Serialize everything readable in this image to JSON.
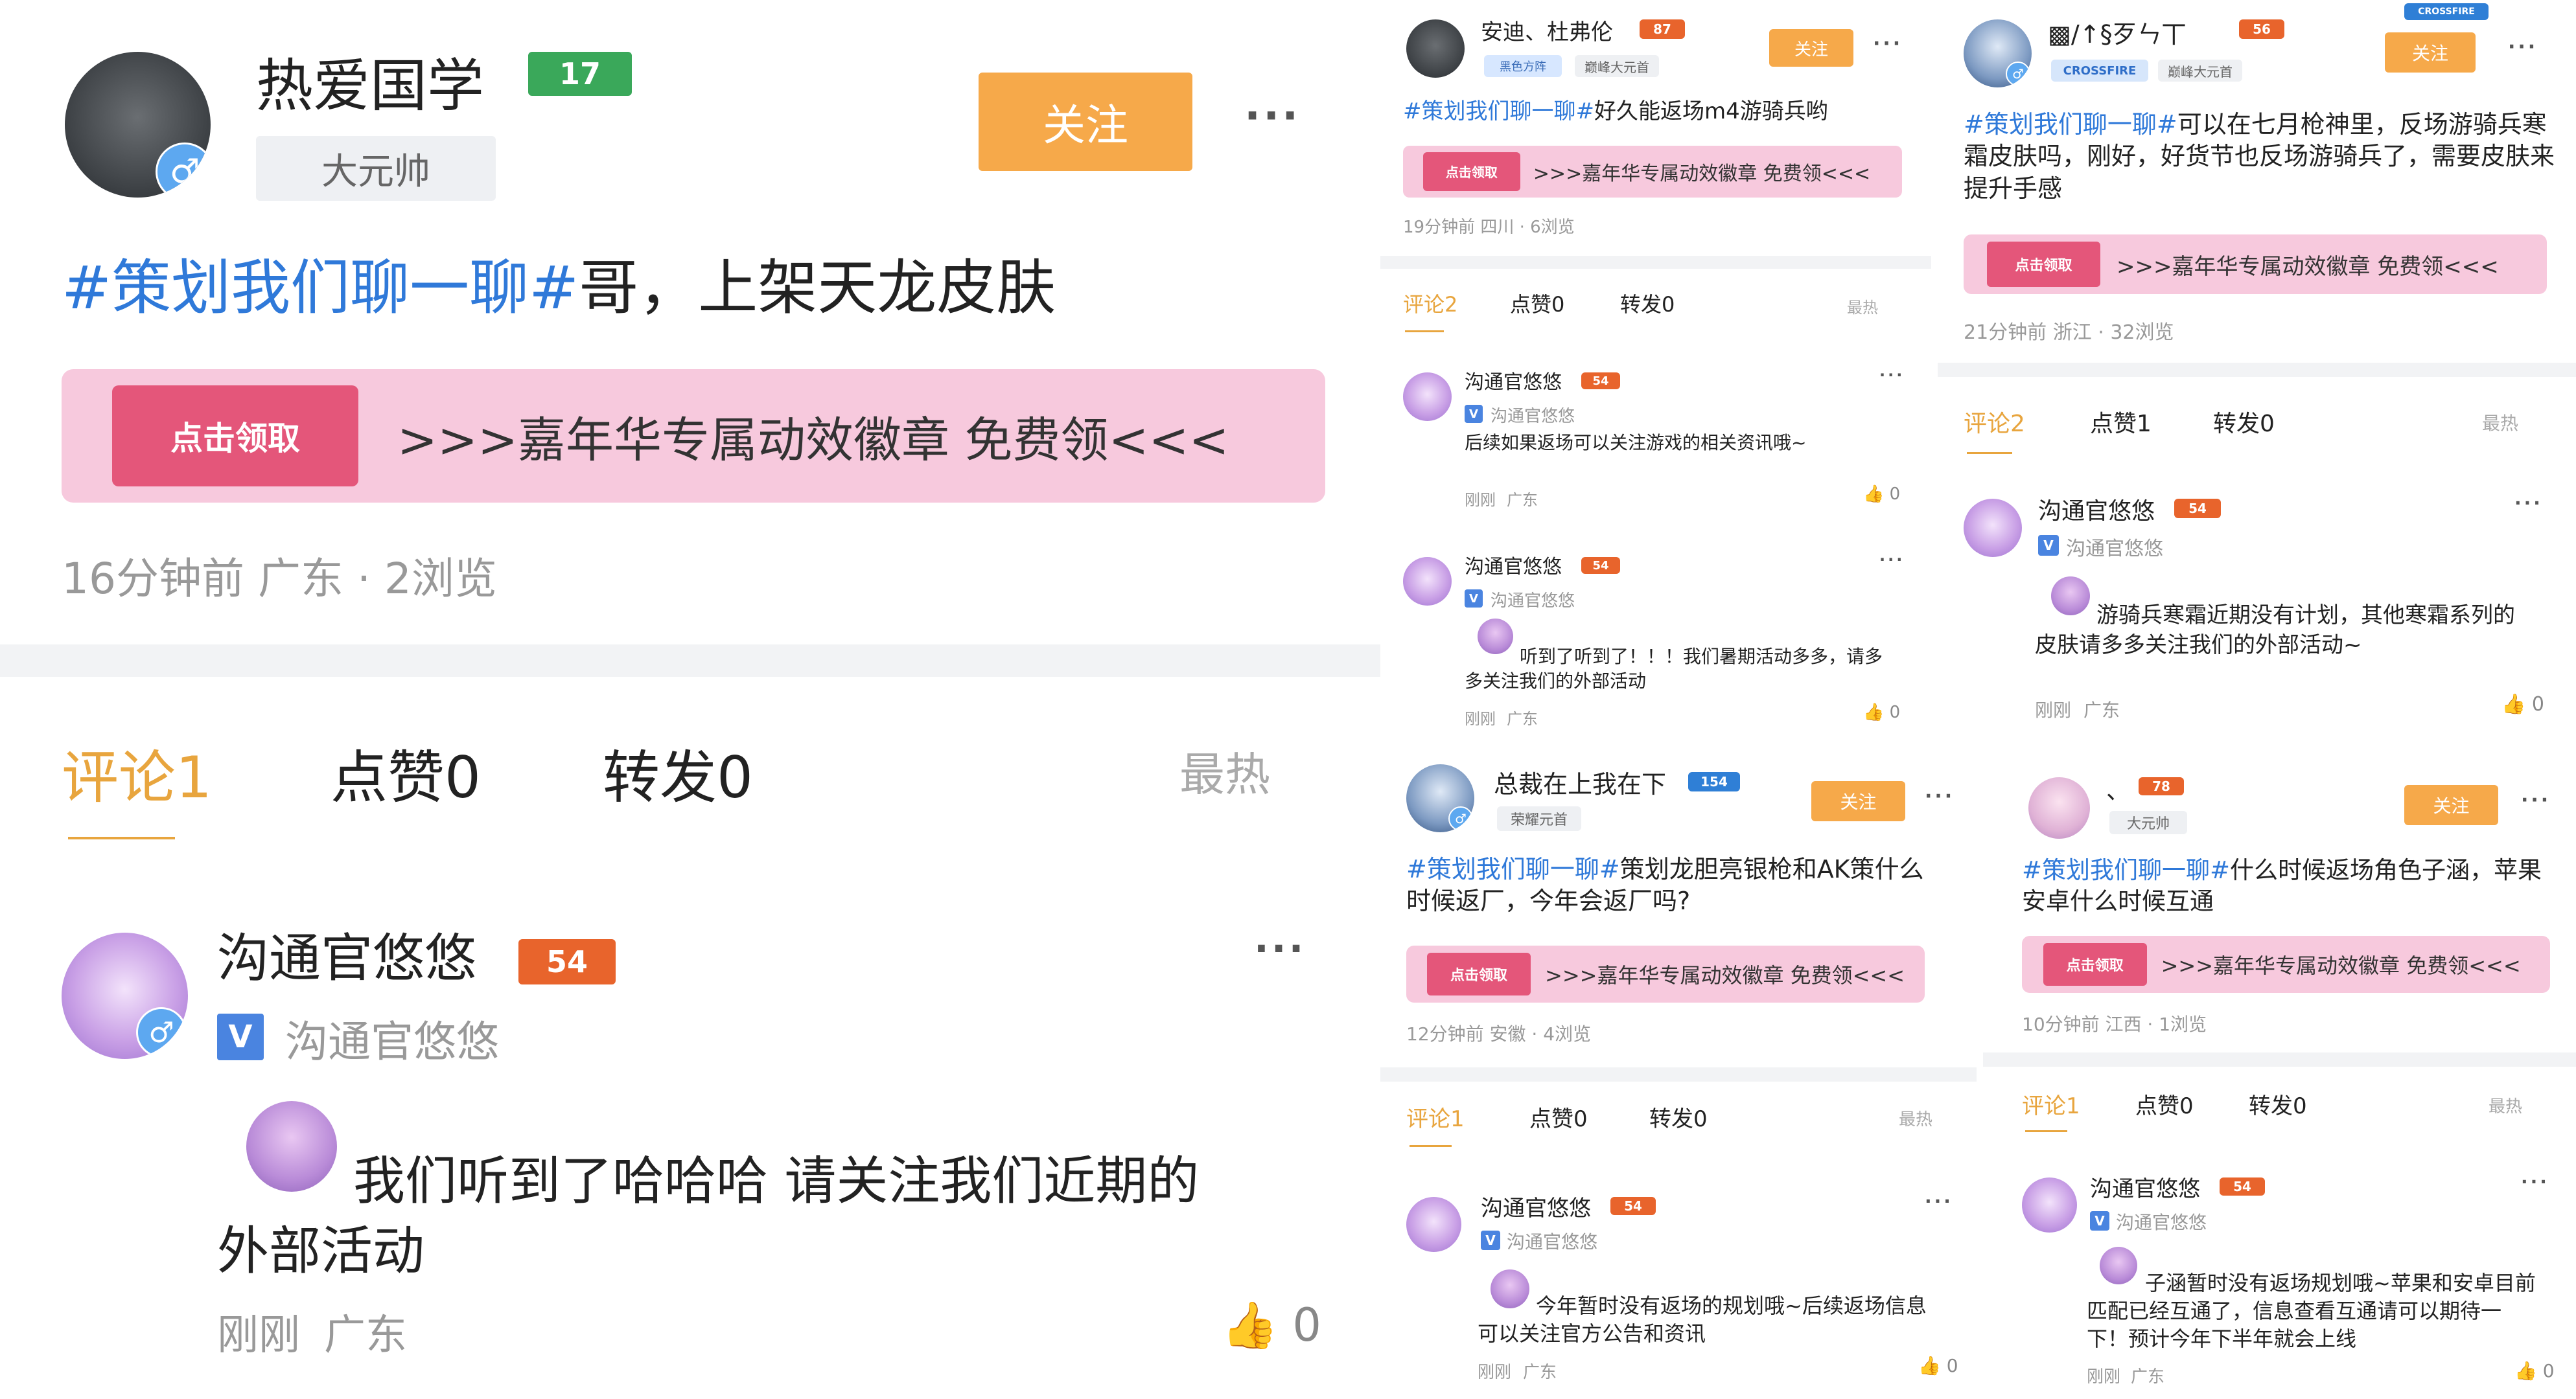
{
  "common": {
    "follow_label": "关注",
    "more_label": "···",
    "banner_claim": "点击领取",
    "banner_text": ">>>嘉年华专属动效徽章 免费领<<<",
    "comment_tab_prefix": "评论",
    "like_tab": "点赞0",
    "forward_tab": "转发0",
    "sort_label": "最热",
    "official_name": "沟通官悠悠",
    "official_level": "54",
    "official_v": "V",
    "just_now": "刚刚",
    "gender_male": "♂"
  },
  "post1": {
    "username": "热爱国学",
    "level": "17",
    "rank": "大元帅",
    "hashtag": "#策划我们聊一聊#",
    "text": "哥，上架天龙皮肤",
    "meta": "16分钟前 广东 · 2浏览",
    "comment_tab": "评论1",
    "comment": {
      "text": "我们听到了哈哈哈 请关注我们近期的外部活动",
      "location": "广东",
      "likes": "0"
    }
  },
  "post2": {
    "username": "安迪、杜弗伦",
    "level": "87",
    "badge": "黑色方阵",
    "rank": "巅峰大元首",
    "hashtag": "#策划我们聊一聊#",
    "text": "好久能返场m4游骑兵哟",
    "meta": "19分钟前 四川 · 6浏览",
    "comment_tab": "评论2",
    "like_tab": "点赞0",
    "comments": [
      {
        "text": "后续如果返场可以关注游戏的相关资讯哦~",
        "location": "广东",
        "likes": "0"
      },
      {
        "text": "听到了听到了！！！我们暑期活动多多，请多多关注我们的外部活动",
        "location": "广东",
        "likes": "0"
      }
    ]
  },
  "post3": {
    "username": "▩/↑§歹ㄣ丅",
    "level": "56",
    "badge": "CROSSFIRE",
    "rank": "巅峰大元首",
    "top_badge": "CROSSFIRE",
    "hashtag": "#策划我们聊一聊#",
    "text": "可以在七月枪神里，反场游骑兵寒霜皮肤吗，刚好，好货节也反场游骑兵了，需要皮肤来提升手感",
    "meta": "21分钟前 浙江 · 32浏览",
    "comment_tab": "评论2",
    "like_tab": "点赞1",
    "comment": {
      "text": "游骑兵寒霜近期没有计划，其他寒霜系列的皮肤请多多关注我们的外部活动~",
      "location": "广东",
      "likes": "0"
    }
  },
  "post4": {
    "username": "总裁在上我在下",
    "level": "154",
    "rank": "荣耀元首",
    "hashtag": "#策划我们聊一聊#",
    "text": "策划龙胆亮银枪和AK策什么时候返厂，今年会返厂吗?",
    "meta": "12分钟前 安徽 · 4浏览",
    "comment_tab": "评论1",
    "comment": {
      "text": "今年暂时没有返场的规划哦~后续返场信息可以关注官方公告和资讯",
      "location": "广东",
      "likes": "0"
    }
  },
  "post5": {
    "username": "、",
    "level": "78",
    "rank": "大元帅",
    "hashtag": "#策划我们聊一聊#",
    "text": "什么时候返场角色子涵，苹果安卓什么时候互通",
    "meta": "10分钟前 江西 · 1浏览",
    "comment_tab": "评论1",
    "comment": {
      "text": "子涵暂时没有返场规划哦~苹果和安卓目前匹配已经互通了，信息查看互通请可以期待一下！预计今年下半年就会上线",
      "location": "广东",
      "likes": "0"
    }
  },
  "colors": {
    "accent_orange": "#f6a94a",
    "tab_active": "#e8a53e",
    "hashtag_blue": "#2f79d9",
    "banner_pink": "#f7c9dd"
  },
  "icons": [
    "gender-male-icon",
    "level-badge-icon",
    "more-icon",
    "sort-icon",
    "thumb-up-icon",
    "claim-hand-icon",
    "verified-v-icon"
  ]
}
